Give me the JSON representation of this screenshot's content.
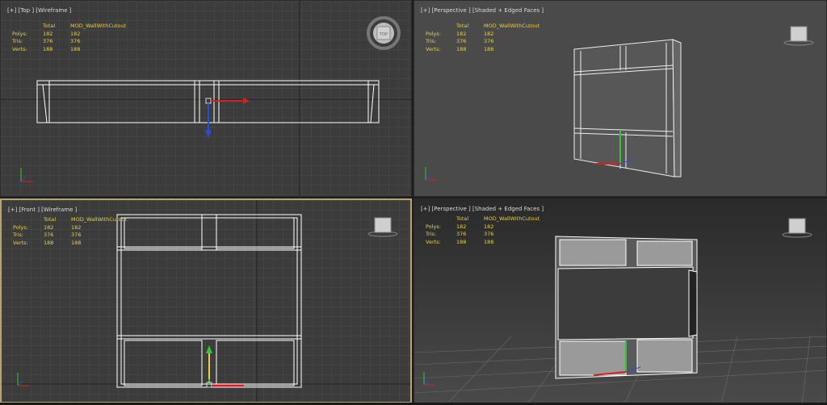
{
  "viewports": {
    "top": {
      "label": "[+] [Top ] [Wireframe ]"
    },
    "persp1": {
      "label": "[+] [Perspective ] [Shaded + Edged Faces ]"
    },
    "front": {
      "label": "[+] [Front ] [Wireframe ]"
    },
    "persp2": {
      "label": "[+] [Perspective ] [Shaded + Edged Faces ]"
    }
  },
  "stats": {
    "headers": [
      "",
      "Total",
      "MOD_WallWithCutout"
    ],
    "rows": [
      {
        "label": "Polys:",
        "total": "182",
        "object": "182"
      },
      {
        "label": "Tris:",
        "total": "376",
        "object": "376"
      },
      {
        "label": "Verts:",
        "total": "188",
        "object": "188"
      }
    ]
  },
  "viewcube": {
    "top_face_label": "TOP"
  },
  "colors": {
    "stats_text": "#e6cf4b",
    "active_border": "#b7a46a",
    "axis_x": "#d62020",
    "axis_y": "#34c534",
    "axis_z": "#2a4bd6"
  },
  "icons": {
    "viewcube": "viewcube-icon",
    "axis_tripod": "axis-tripod-icon",
    "gizmo": "transform-gizmo-icon"
  }
}
